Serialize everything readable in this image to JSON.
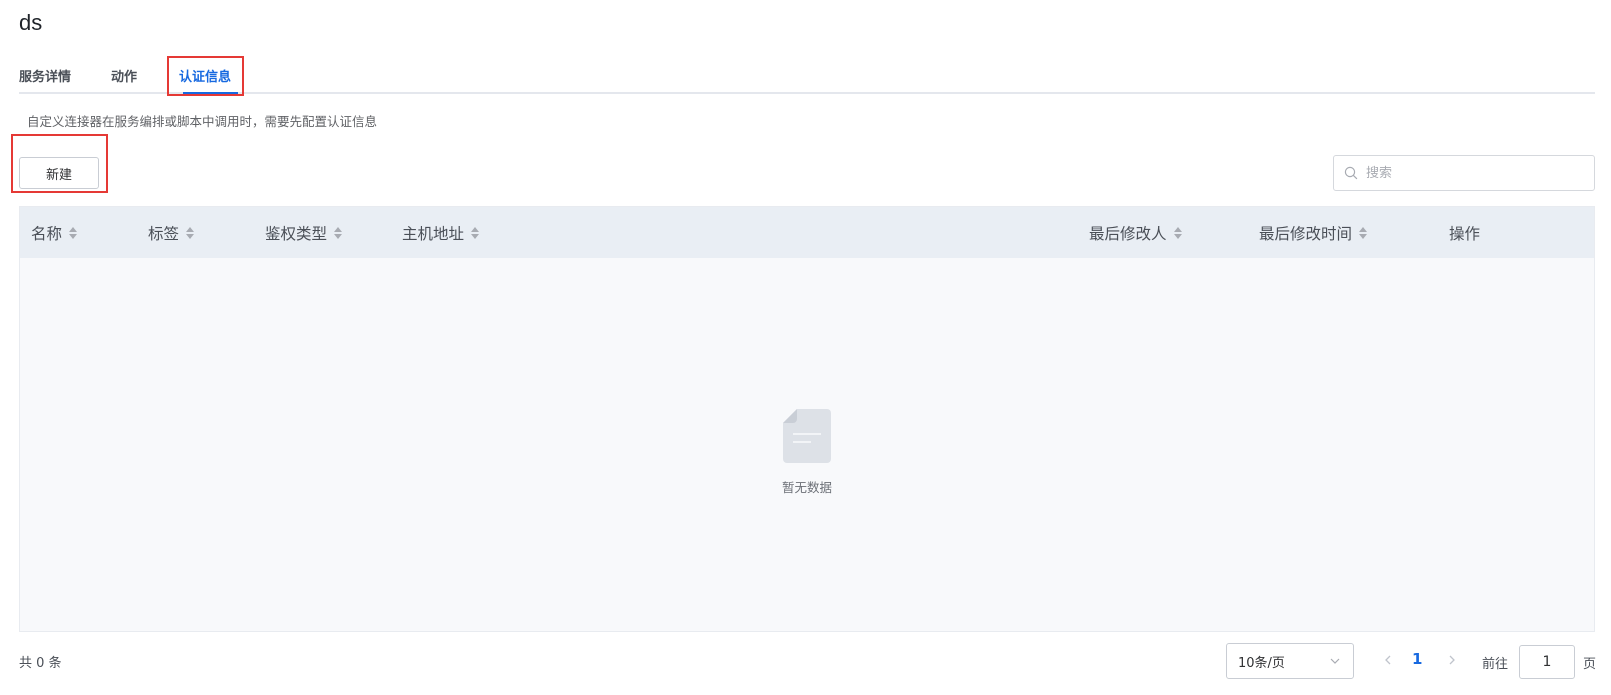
{
  "page": {
    "title": "ds"
  },
  "tabs": [
    {
      "label": "服务详情"
    },
    {
      "label": "动作"
    },
    {
      "label": "认证信息"
    }
  ],
  "description": "自定义连接器在服务编排或脚本中调用时，需要先配置认证信息",
  "toolbar": {
    "new_label": "新建",
    "search_placeholder": "搜索"
  },
  "table": {
    "columns": [
      {
        "label": "名称"
      },
      {
        "label": "标签"
      },
      {
        "label": "鉴权类型"
      },
      {
        "label": "主机地址"
      },
      {
        "label": "最后修改人"
      },
      {
        "label": "最后修改时间"
      },
      {
        "label": "操作"
      }
    ],
    "empty_text": "暂无数据"
  },
  "pagination": {
    "total_text": "共 0 条",
    "page_size": "10条/页",
    "current_page": "1",
    "goto_prefix": "前往",
    "goto_value": "1",
    "goto_suffix": "页"
  },
  "colors": {
    "accent": "#1769e0",
    "highlight": "#e53935"
  }
}
